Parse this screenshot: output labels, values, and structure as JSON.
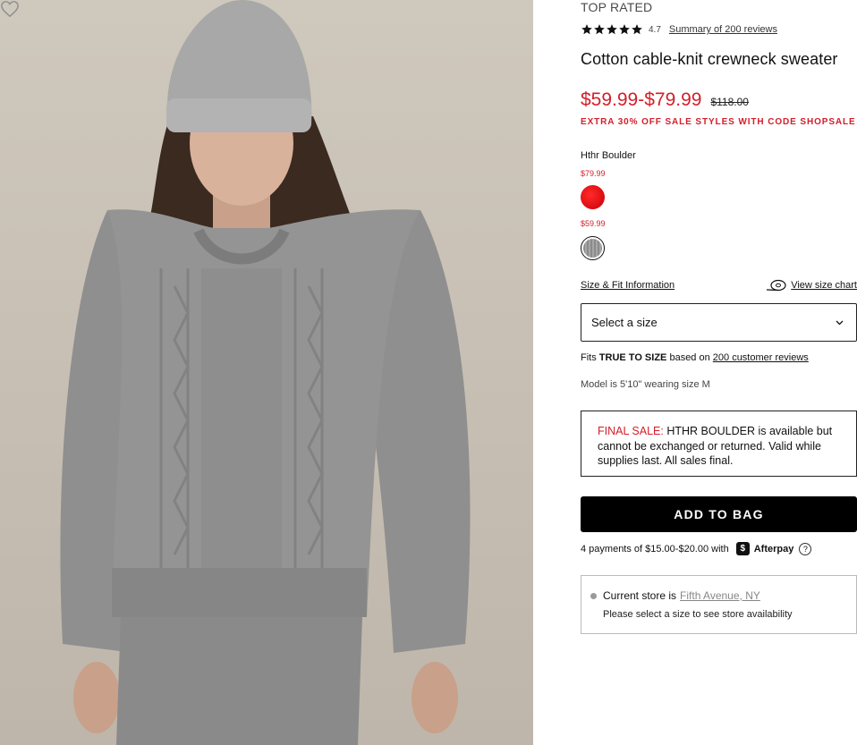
{
  "product": {
    "badge": "TOP RATED",
    "rating": "4.7",
    "reviews_link": "Summary of 200 reviews",
    "title": "Cotton cable-knit crewneck sweater",
    "price_range": "$59.99-$79.99",
    "original_price": "$118.00",
    "promo": "EXTRA 30% OFF SALE STYLES WITH CODE SHOPSALE",
    "color_name": "Hthr Boulder",
    "swatches": [
      {
        "price": "$79.99",
        "color": "#e3121a"
      },
      {
        "price": "$59.99",
        "color": "#999999"
      }
    ],
    "fit_info_link": "Size & Fit Information",
    "size_chart_link": "View size chart",
    "size_select": "Select a size",
    "fits_prefix": "Fits",
    "fits_bold": "TRUE TO SIZE",
    "fits_mid": "based on",
    "fits_link": "200 customer reviews",
    "model_note": "Model is 5'10\" wearing size M",
    "final_sale_label": "FINAL SALE:",
    "final_sale_text": "HTHR BOULDER is available but cannot be exchanged or returned. Valid while supplies last. All sales final.",
    "add_to_bag": "ADD TO BAG",
    "afterpay_text": "4 payments of $15.00-$20.00 with",
    "afterpay_badge": "$",
    "afterpay_name": "Afterpay",
    "afterpay_help": "?",
    "store_label": "Current store is",
    "store_name": "Fifth Avenue, NY",
    "store_note": "Please select a size to see store availability"
  },
  "colors": {
    "sale_red": "#d41e2a",
    "button_black": "#000000"
  },
  "icons": {
    "wishlist": "heart-icon",
    "rating": "star-icon",
    "size_chart": "tape-measure-icon",
    "select": "chevron-down-icon"
  }
}
